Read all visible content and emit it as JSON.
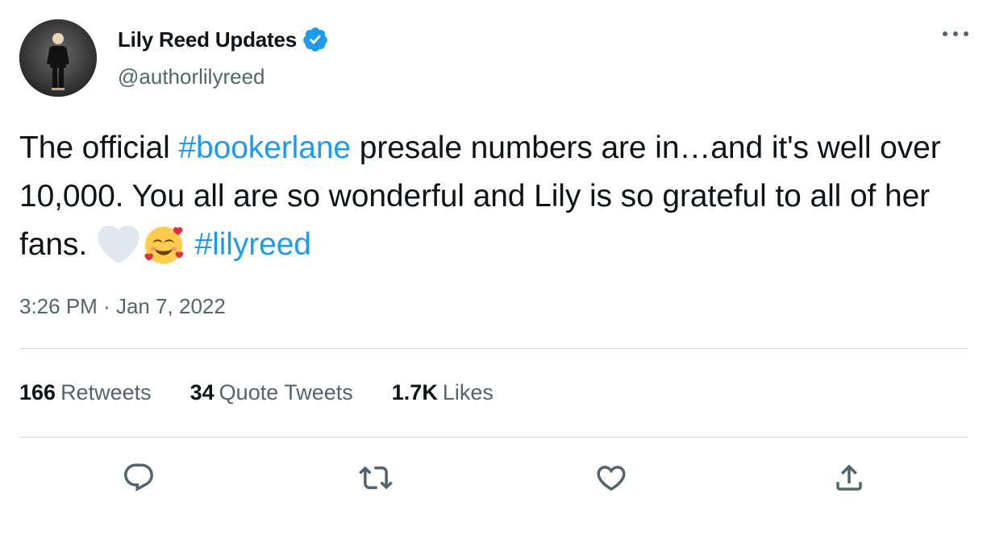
{
  "author": {
    "name": "Lily Reed Updates",
    "handle": "@authorlilyreed",
    "verified": true,
    "avatar_icon": "person-in-black-suit-photo"
  },
  "tweet": {
    "segments": [
      {
        "type": "text",
        "value": "The official "
      },
      {
        "type": "hashtag",
        "value": "#bookerlane"
      },
      {
        "type": "text",
        "value": " presale numbers are in…and it's well over 10,000. You all are so wonderful and Lily is so grateful to all of her fans. "
      },
      {
        "type": "emoji",
        "value": "white-heart"
      },
      {
        "type": "emoji",
        "value": "smiling-face-with-hearts"
      },
      {
        "type": "text",
        "value": " "
      },
      {
        "type": "hashtag",
        "value": "#lilyreed"
      }
    ]
  },
  "timestamp": {
    "time": "3:26 PM",
    "separator": " · ",
    "date": "Jan 7, 2022"
  },
  "stats": {
    "retweets": {
      "count": "166",
      "label": "Retweets"
    },
    "quote_tweets": {
      "count": "34",
      "label": "Quote Tweets"
    },
    "likes": {
      "count": "1.7K",
      "label": "Likes"
    }
  },
  "actions": [
    "reply-icon",
    "retweet-icon",
    "like-icon",
    "share-icon"
  ],
  "colors": {
    "accent": "#1d9bf0",
    "secondary_text": "#536471",
    "primary_text": "#0f1419",
    "divider": "#cfd9de"
  }
}
